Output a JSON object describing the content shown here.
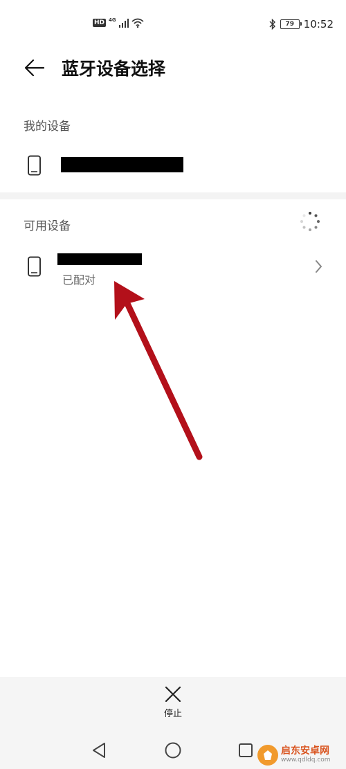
{
  "status_bar": {
    "hd": "HD",
    "network": "4G",
    "battery": "79",
    "time": "10:52",
    "icons": [
      "signal-icon",
      "wifi-icon",
      "bluetooth-icon",
      "battery-icon"
    ]
  },
  "header": {
    "title": "蓝牙设备选择",
    "back_icon": "arrow-left-icon"
  },
  "sections": {
    "my_devices": {
      "label": "我的设备",
      "devices": [
        {
          "name_redacted": true,
          "icon": "phone-icon"
        }
      ]
    },
    "available_devices": {
      "label": "可用设备",
      "scanning": true,
      "devices": [
        {
          "name_redacted": true,
          "status": "已配对",
          "icon": "phone-icon"
        }
      ]
    }
  },
  "bottom": {
    "stop_label": "停止",
    "stop_icon": "close-icon"
  },
  "nav": [
    "nav-back-icon",
    "nav-home-icon",
    "nav-recent-icon"
  ],
  "watermark": {
    "name": "启东安卓网",
    "url": "www.qdldq.com"
  },
  "colors": {
    "annotation_arrow": "#b3101a",
    "watermark_brand": "#d9531e",
    "watermark_logo": "#f19a2c"
  }
}
